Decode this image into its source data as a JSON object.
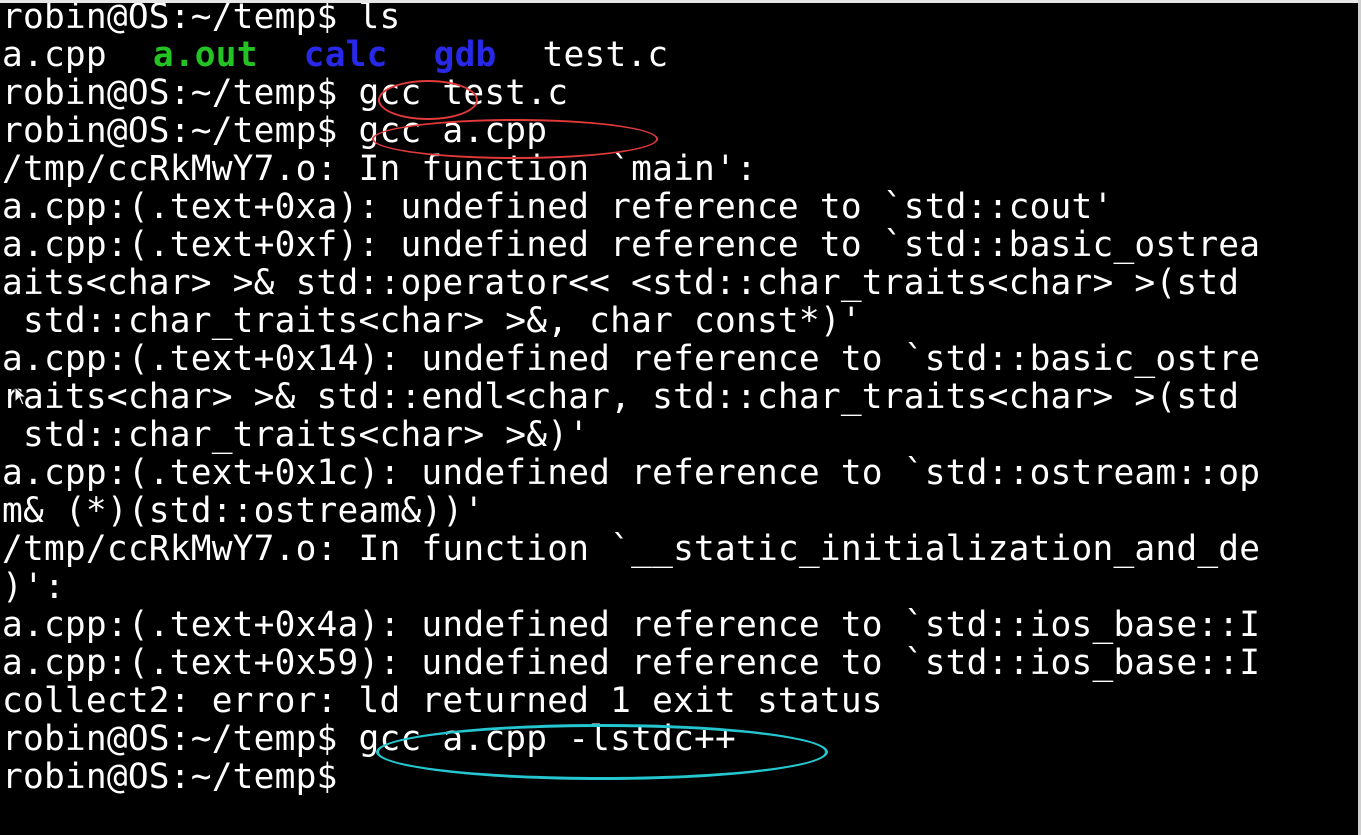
{
  "terminal": {
    "lines": [
      "robin@OS:~/temp$ ls",
      "",
      "robin@OS:~/temp$ gcc test.c",
      "robin@OS:~/temp$ gcc a.cpp",
      "/tmp/ccRkMwY7.o: In function `main':",
      "a.cpp:(.text+0xa): undefined reference to `std::cout'",
      "a.cpp:(.text+0xf): undefined reference to `std::basic_ostrea",
      "aits<char> >& std::operator<< <std::char_traits<char> >(std",
      " std::char_traits<char> >&, char const*)'",
      "a.cpp:(.text+0x14): undefined reference to `std::basic_ostre",
      "raits<char> >& std::endl<char, std::char_traits<char> >(std",
      " std::char_traits<char> >&)'",
      "a.cpp:(.text+0x1c): undefined reference to `std::ostream::op",
      "m& (*)(std::ostream&))'",
      "/tmp/ccRkMwY7.o: In function `__static_initialization_and_de",
      ")':",
      "a.cpp:(.text+0x4a): undefined reference to `std::ios_base::I",
      "a.cpp:(.text+0x59): undefined reference to `std::ios_base::I",
      "collect2: error: ld returned 1 exit status",
      "robin@OS:~/temp$ gcc a.cpp -lstdc++",
      "robin@OS:~/temp$"
    ],
    "ls_output": {
      "file1": "a.cpp",
      "file2": "a.out",
      "file3": "calc",
      "file4": "gdb",
      "file5": "test.c"
    }
  },
  "colors": {
    "background": "#000000",
    "text": "#ffffff",
    "executable": "#22c322",
    "directory": "#2828e8",
    "annotation_red": "#e23a3a",
    "annotation_cyan": "#25c6cf"
  },
  "icons": {
    "mouse_cursor": "mouse-pointer-icon"
  }
}
